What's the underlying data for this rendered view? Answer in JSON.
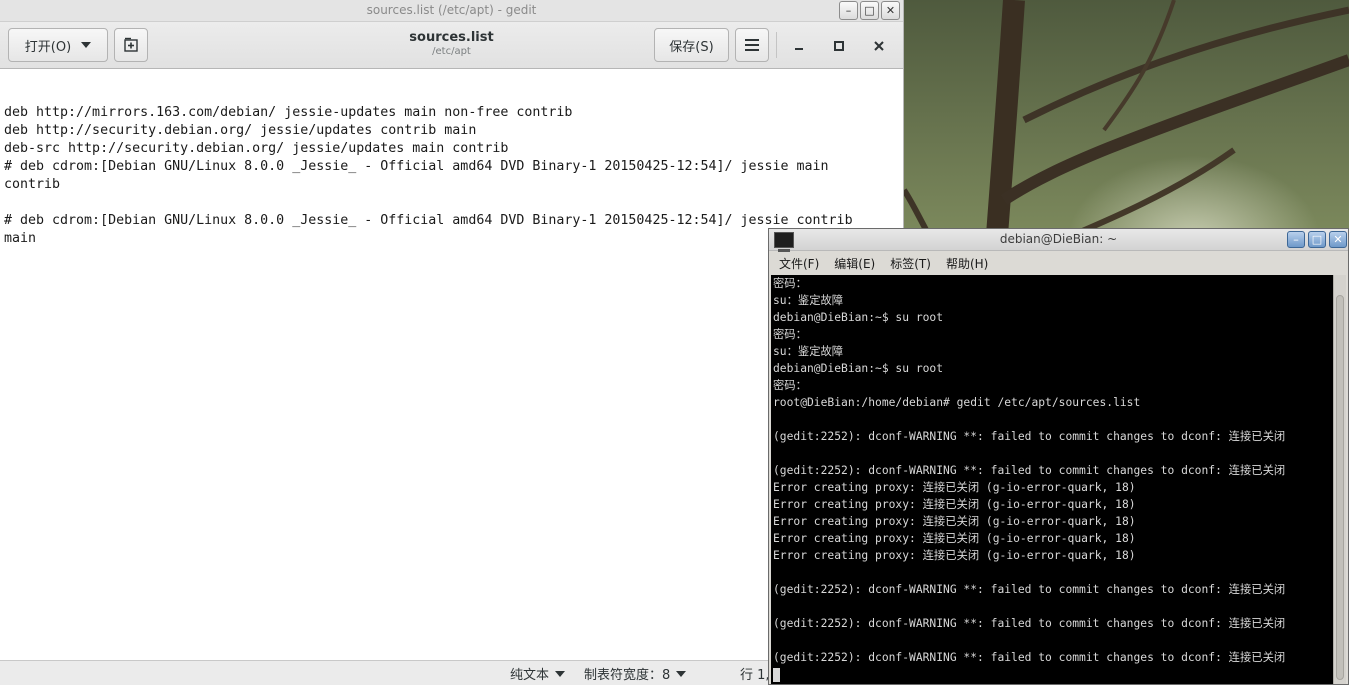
{
  "gedit": {
    "wm_title": "sources.list (/etc/apt) - gedit",
    "open_label": "打开(O)",
    "save_label": "保存(S)",
    "file_name": "sources.list",
    "file_path": "/etc/apt",
    "lines": [
      "deb http://mirrors.163.com/debian/ jessie-updates main non-free contrib",
      "deb http://security.debian.org/ jessie/updates contrib main",
      "deb-src http://security.debian.org/ jessie/updates main contrib",
      "# deb cdrom:[Debian GNU/Linux 8.0.0 _Jessie_ - Official amd64 DVD Binary-1 20150425-12:54]/ jessie main",
      "contrib",
      "",
      "# deb cdrom:[Debian GNU/Linux 8.0.0 _Jessie_ - Official amd64 DVD Binary-1 20150425-12:54]/ jessie contrib",
      "main"
    ],
    "status": {
      "language": "纯文本",
      "tab_width": "制表符宽度：8",
      "position": "行 1,"
    }
  },
  "terminal": {
    "title": "debian@DieBian: ~",
    "menu": [
      "文件(F)",
      "编辑(E)",
      "标签(T)",
      "帮助(H)"
    ],
    "lines": [
      "密码：",
      "su：鉴定故障",
      "debian@DieBian:~$ su root",
      "密码：",
      "su：鉴定故障",
      "debian@DieBian:~$ su root",
      "密码：",
      "root@DieBian:/home/debian# gedit /etc/apt/sources.list",
      "",
      "(gedit:2252): dconf-WARNING **: failed to commit changes to dconf: 连接已关闭",
      "",
      "(gedit:2252): dconf-WARNING **: failed to commit changes to dconf: 连接已关闭",
      "Error creating proxy: 连接已关闭 (g-io-error-quark, 18)",
      "Error creating proxy: 连接已关闭 (g-io-error-quark, 18)",
      "Error creating proxy: 连接已关闭 (g-io-error-quark, 18)",
      "Error creating proxy: 连接已关闭 (g-io-error-quark, 18)",
      "Error creating proxy: 连接已关闭 (g-io-error-quark, 18)",
      "",
      "(gedit:2252): dconf-WARNING **: failed to commit changes to dconf: 连接已关闭",
      "",
      "(gedit:2252): dconf-WARNING **: failed to commit changes to dconf: 连接已关闭",
      "",
      "(gedit:2252): dconf-WARNING **: failed to commit changes to dconf: 连接已关闭"
    ]
  },
  "icons": {
    "new_tab": "new-tab-icon",
    "menu": "hamburger-menu-icon",
    "minimize": "minimize-icon",
    "maximize": "maximize-icon",
    "close": "close-icon"
  },
  "colors": {
    "terminal_bg": "#000000",
    "terminal_fg": "#d8d8d8",
    "editor_bg": "#ffffff"
  }
}
